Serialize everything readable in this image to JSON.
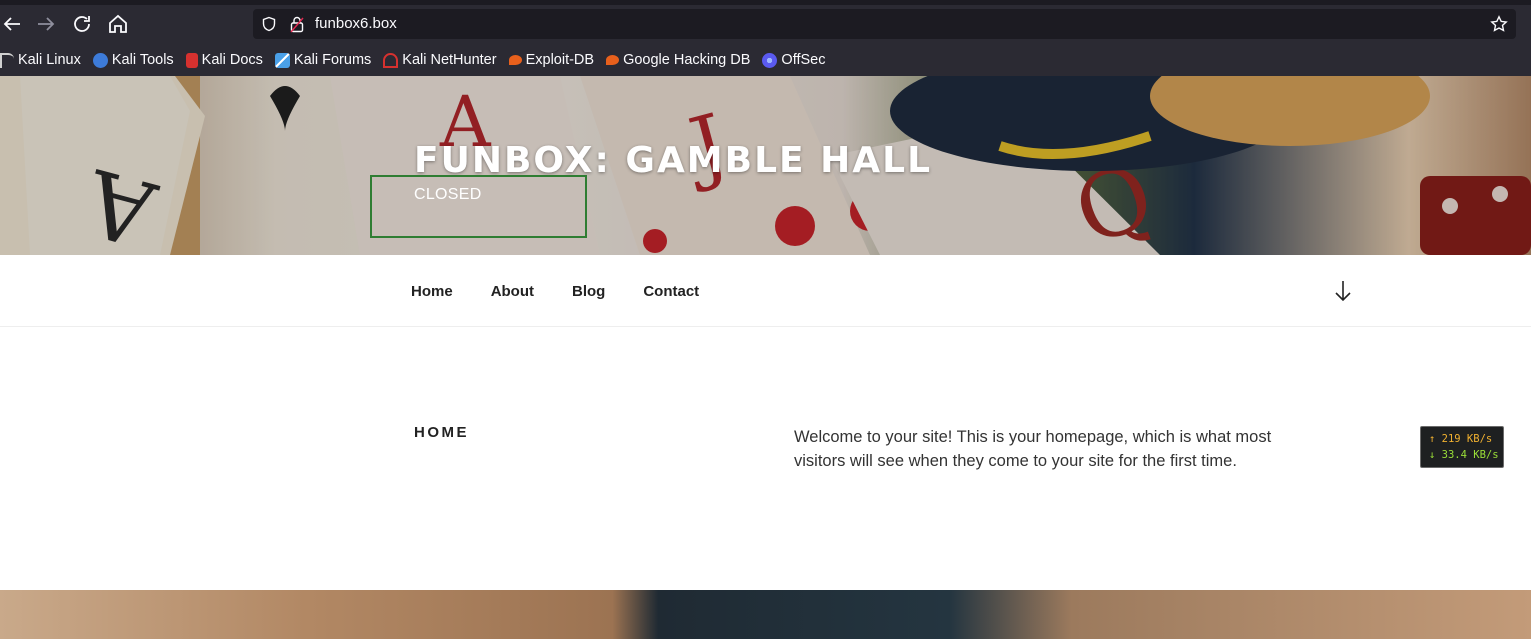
{
  "browser": {
    "url": "funbox6.box",
    "bookmarks": [
      {
        "label": "Kali Linux",
        "icon": "kali-dragon-icon",
        "color": "#d0d0d0"
      },
      {
        "label": "Kali Tools",
        "icon": "kali-tools-icon",
        "color": "#3d7bd9"
      },
      {
        "label": "Kali Docs",
        "icon": "kali-docs-icon",
        "color": "#d6312f"
      },
      {
        "label": "Kali Forums",
        "icon": "kali-forums-icon",
        "color": "#4aa0e8"
      },
      {
        "label": "Kali NetHunter",
        "icon": "kali-nethunter-icon",
        "color": "#d6312f"
      },
      {
        "label": "Exploit-DB",
        "icon": "exploit-db-icon",
        "color": "#e8601c"
      },
      {
        "label": "Google Hacking DB",
        "icon": "ghdb-icon",
        "color": "#e8601c"
      },
      {
        "label": "OffSec",
        "icon": "offsec-icon",
        "color": "#5a5af0"
      }
    ]
  },
  "site": {
    "title": "FUNBOX: GAMBLE HALL",
    "description": "CLOSED"
  },
  "nav": {
    "items": [
      "Home",
      "About",
      "Blog",
      "Contact"
    ]
  },
  "page": {
    "heading": "HOME",
    "body": "Welcome to your site! This is your homepage, which is what most visitors will see when they come to your site for the first time."
  },
  "netspeed": {
    "up": "↑ 219 KB/s",
    "down": "↓ 33.4 KB/s"
  }
}
